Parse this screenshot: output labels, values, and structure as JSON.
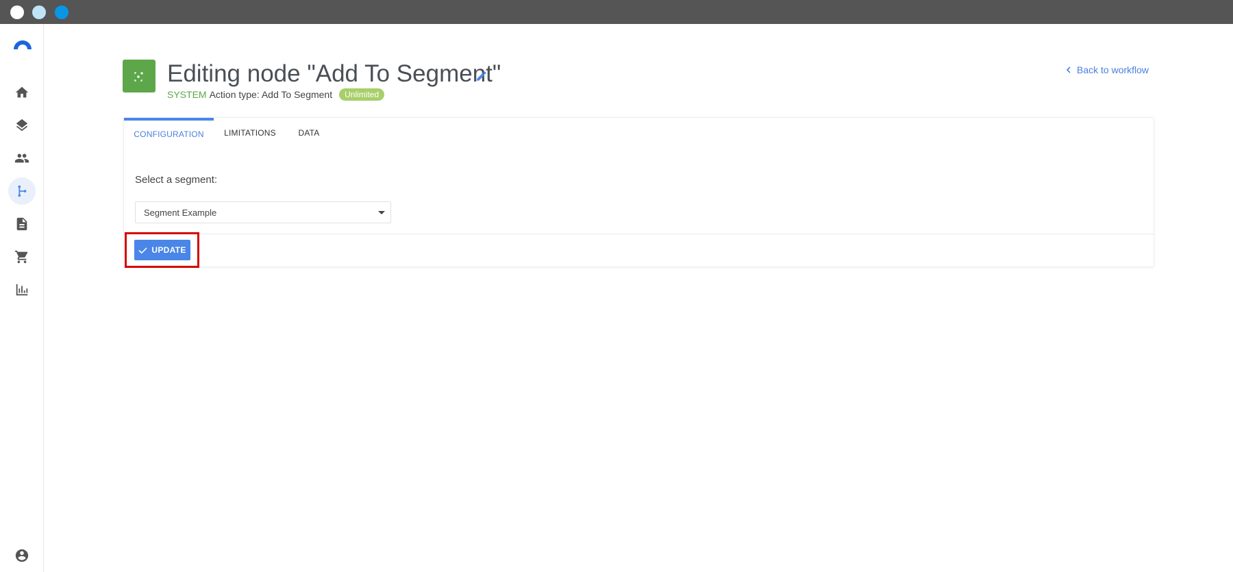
{
  "window": {
    "dots": [
      "close",
      "minimize",
      "maximize"
    ]
  },
  "sidebar": {
    "items": [
      {
        "name": "home-icon"
      },
      {
        "name": "layers-icon"
      },
      {
        "name": "people-icon"
      },
      {
        "name": "workflow-icon",
        "active": true
      },
      {
        "name": "document-icon"
      },
      {
        "name": "cart-icon"
      },
      {
        "name": "bar-chart-icon"
      },
      {
        "name": "account-icon"
      }
    ]
  },
  "header": {
    "title": "Editing node \"Add To Segment\"",
    "system_label": "SYSTEM",
    "action_type": "Action type: Add To Segment",
    "badge": "Unlimited",
    "back_link": "Back to workflow"
  },
  "tabs": [
    {
      "label": "CONFIGURATION",
      "active": true
    },
    {
      "label": "LIMITATIONS"
    },
    {
      "label": "DATA"
    }
  ],
  "form": {
    "segment_label": "Select a segment:",
    "segment_value": "Segment Example"
  },
  "actions": {
    "update_label": "UPDATE"
  },
  "colors": {
    "accent": "#4a86e8",
    "success": "#5ea64a",
    "highlight": "#d60000",
    "titlebar": "#555555"
  }
}
